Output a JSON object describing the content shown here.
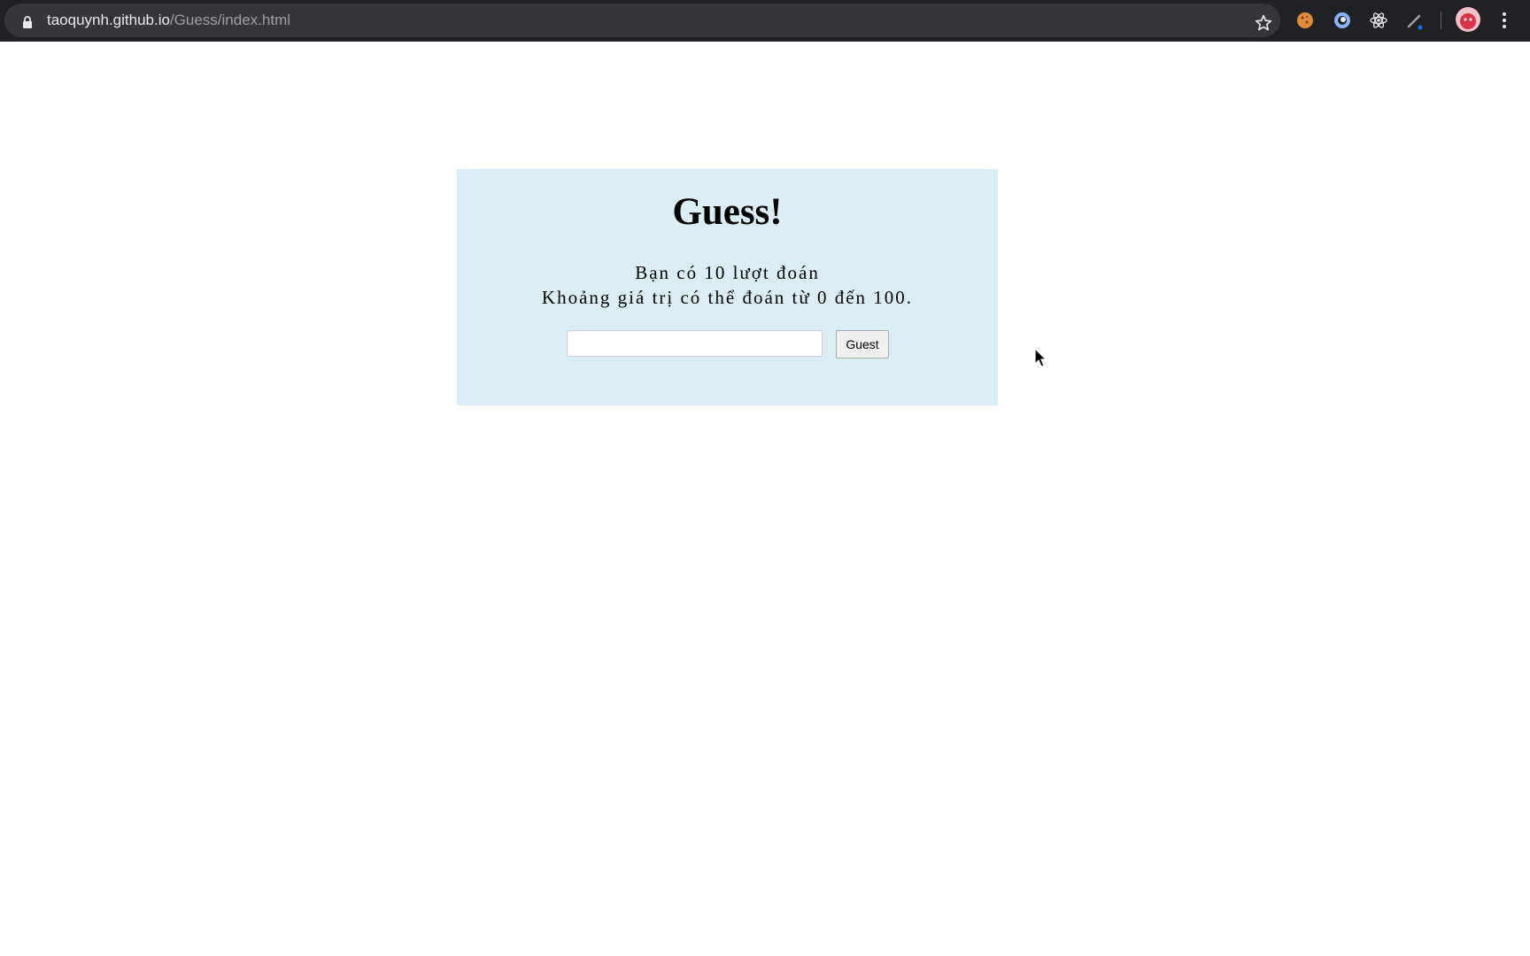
{
  "browser": {
    "url_host": "taoquynh.github.io",
    "url_path": "/Guess/index.html",
    "icons": [
      "lock-icon",
      "bookmark-star-icon",
      "cookie-extension-icon",
      "ring-extension-icon",
      "react-devtools-icon",
      "pen-extension-icon",
      "profile-avatar",
      "more-menu-icon"
    ]
  },
  "game": {
    "title": "Guess!",
    "turns_text": "Bạn có 10 lượt đoán",
    "range_text": "Khoảng giá trị có thể đoán từ 0 đến 100.",
    "input_value": "",
    "button_label": "Guest"
  },
  "colors": {
    "card_background": "#dbedf5",
    "browser_chrome": "#202124"
  }
}
